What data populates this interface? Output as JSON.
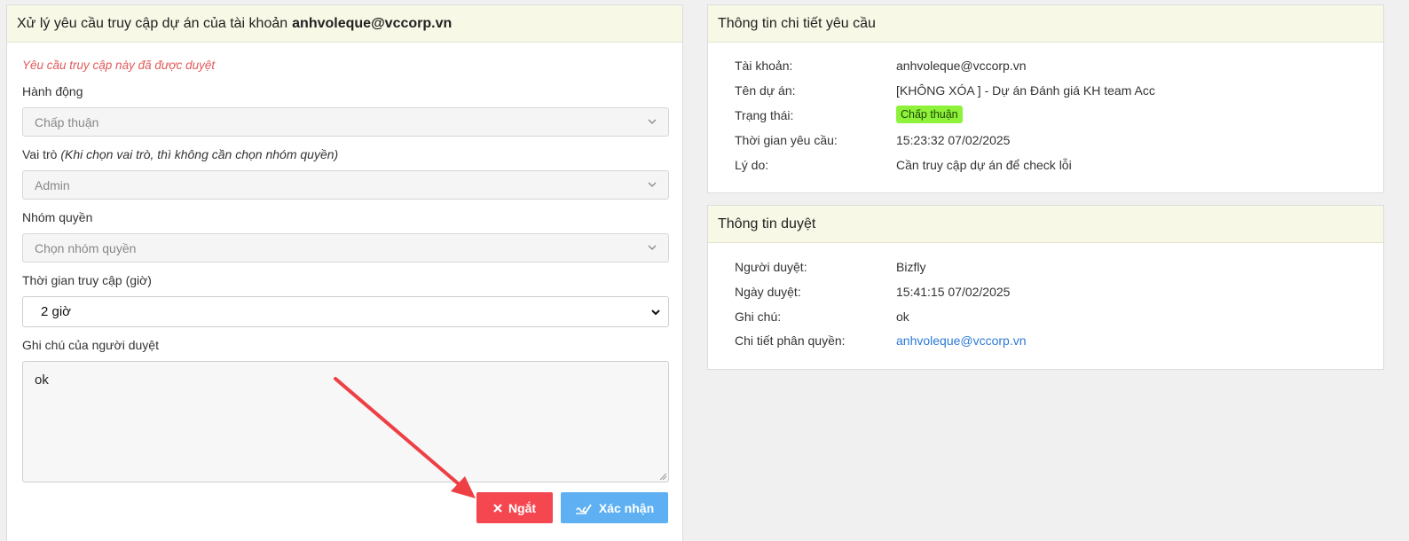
{
  "left_panel": {
    "title_prefix": "Xử lý yêu cầu truy cập dự án của tài khoản",
    "title_account": "anhvoleque@vccorp.vn",
    "notice": "Yêu cầu truy cập này đã được duyệt",
    "action_label": "Hành động",
    "action_value": "Chấp thuận",
    "role_label": "Vai trò",
    "role_hint": "(Khi chọn vai trò, thì không cần chọn nhóm quyền)",
    "role_value": "Admin",
    "group_label": "Nhóm quyền",
    "group_placeholder": "Chọn nhóm quyền",
    "duration_label": "Thời gian truy cập (giờ)",
    "duration_value": "2 giờ",
    "note_label": "Ghi chú của người duyệt",
    "note_value": "ok",
    "cancel_label": "Ngắt",
    "confirm_label": "Xác nhận"
  },
  "request_info": {
    "title": "Thông tin chi tiết yêu cầu",
    "rows": [
      {
        "label": "Tài khoản:",
        "value": "anhvoleque@vccorp.vn"
      },
      {
        "label": "Tên dự án:",
        "value": "[KHÔNG XÓA ] - Dự án Đánh giá KH team Acc"
      },
      {
        "label": "Trạng thái:",
        "value": "Chấp thuận"
      },
      {
        "label": "Thời gian yêu cầu:",
        "value": "15:23:32 07/02/2025"
      },
      {
        "label": "Lý do:",
        "value": "Cần truy cập dự án để check lỗi"
      }
    ]
  },
  "approval_info": {
    "title": "Thông tin duyệt",
    "rows": [
      {
        "label": "Người duyệt:",
        "value": "Bizfly"
      },
      {
        "label": "Ngày duyệt:",
        "value": "15:41:15 07/02/2025"
      },
      {
        "label": "Ghi chú:",
        "value": "ok"
      },
      {
        "label": "Chi tiết phân quyền:",
        "value": "anhvoleque@vccorp.vn"
      }
    ]
  },
  "colors": {
    "header_bg": "#f8f8e6",
    "cancel": "#f5474f",
    "confirm": "#5eb0f2",
    "status_badge": "#8ef23a",
    "link": "#2c7ad6",
    "annotation_arrow": "#ee4044"
  }
}
